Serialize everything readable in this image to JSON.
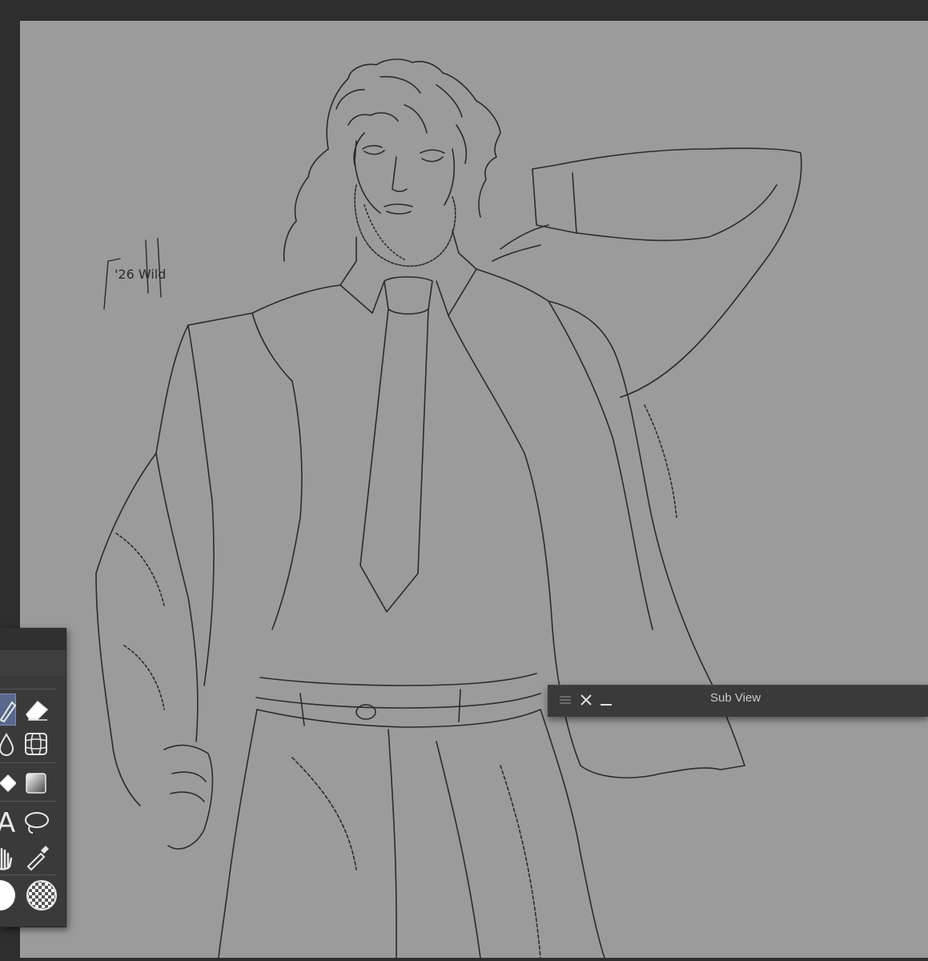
{
  "window": {
    "background": "#2e2e2e"
  },
  "canvas": {
    "background": "#9b9b9b",
    "signature_text": "'26 Wild"
  },
  "tool_palette": {
    "tools": [
      {
        "icon": "pen-icon",
        "active": true
      },
      {
        "icon": "eraser-icon",
        "active": false
      },
      {
        "icon": "blend-drop-icon",
        "active": false
      },
      {
        "icon": "mesh-transform-icon",
        "active": false
      },
      {
        "icon": "fill-bucket-icon",
        "active": false
      },
      {
        "icon": "gradient-icon",
        "active": false
      },
      {
        "icon": "text-icon",
        "active": false
      },
      {
        "icon": "lasso-icon",
        "active": false
      },
      {
        "icon": "hand-icon",
        "active": false
      },
      {
        "icon": "eyedropper-icon",
        "active": false
      },
      {
        "icon": "main-color-swatch",
        "active": false
      },
      {
        "icon": "transparent-color-swatch",
        "active": false
      }
    ],
    "text_tool_glyph": "A",
    "main_color": "#ffffff"
  },
  "sub_view": {
    "title": "Sub View",
    "menu_icon": "hamburger-menu-icon",
    "close_icon": "close-icon",
    "minimize_icon": "minimize-icon"
  }
}
